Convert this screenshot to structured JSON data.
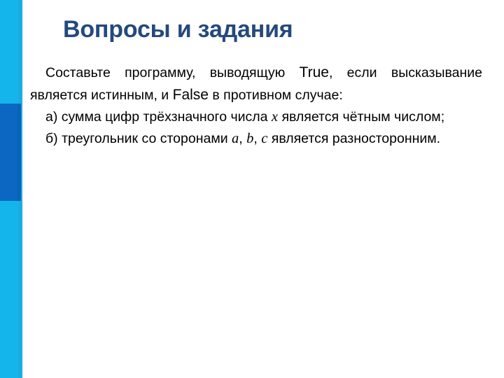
{
  "slide": {
    "title": "Вопросы и задания",
    "title_color": "#24497D",
    "background_color": "#ffffff"
  },
  "decorations": {
    "left_bar_cyan_color": "#13B5EA",
    "left_bar_navy_color": "#0B67C2"
  },
  "content": {
    "paragraphs": [
      {
        "id": "task-intro",
        "segments": [
          {
            "type": "text",
            "value": "Составьте программу, выводящую "
          },
          {
            "type": "literal",
            "value": "True"
          },
          {
            "type": "text",
            "value": ", если высказывание является истинным, и "
          },
          {
            "type": "literal",
            "value": "False"
          },
          {
            "type": "text",
            "value": " в противном случае:"
          }
        ],
        "plain": "Составьте программу, выводящую True, если высказывание является истинным, и False в противном случае:"
      },
      {
        "id": "task-a",
        "segments": [
          {
            "type": "text",
            "value": "а) сумма цифр трёхзначного числа "
          },
          {
            "type": "variable",
            "value": "x"
          },
          {
            "type": "text",
            "value": " является чётным числом;"
          }
        ],
        "plain": "а) сумма цифр трёхзначного числа x является чётным числом;"
      },
      {
        "id": "task-b",
        "segments": [
          {
            "type": "text",
            "value": "б) треугольник со сторонами "
          },
          {
            "type": "variable",
            "value": "a"
          },
          {
            "type": "text",
            "value": ", "
          },
          {
            "type": "variable",
            "value": "b"
          },
          {
            "type": "text",
            "value": ", "
          },
          {
            "type": "variable",
            "value": "c"
          },
          {
            "type": "text",
            "value": " является разносторонним."
          }
        ],
        "plain": "б) треугольник со сторонами a, b, c является разносторонним."
      }
    ]
  },
  "parts": {
    "intro_1": "Составьте программу, выводящую ",
    "literal_true": "True",
    "intro_2": ", если высказывание является истинным, и ",
    "literal_false": "False",
    "intro_3": " в противном случае:",
    "a_1": "а) сумма цифр трёхзначного числа ",
    "var_x": "x",
    "a_2": " является чётным числом;",
    "b_1": "б) треугольник со сторонами ",
    "var_a": "a",
    "comma_1": ", ",
    "var_b": "b",
    "comma_2": ", ",
    "var_c": "c",
    "b_2": " является разносторонним."
  }
}
